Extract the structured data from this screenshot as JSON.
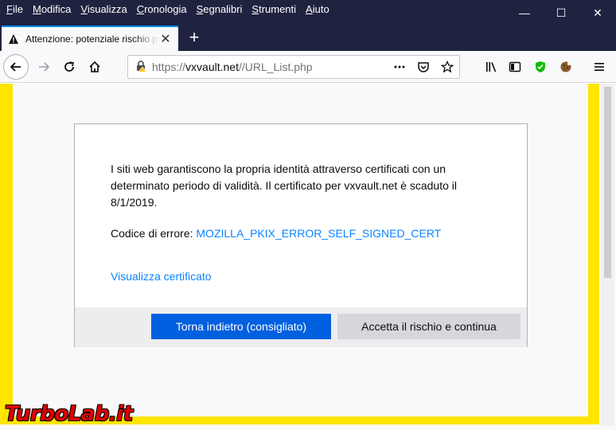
{
  "menu": [
    "File",
    "Modifica",
    "Visualizza",
    "Cronologia",
    "Segnalibri",
    "Strumenti",
    "Aiuto"
  ],
  "menu_access_keys": [
    "F",
    "M",
    "V",
    "C",
    "S",
    "S",
    "A"
  ],
  "window_controls": {
    "minimize": "—",
    "maximize": "☐",
    "close": "✕"
  },
  "tab": {
    "title": "Attenzione: potenziale rischio per la sicurezza",
    "icon": "warning-icon",
    "close": "✕"
  },
  "newtab": "+",
  "urlbar": {
    "scheme": "https://",
    "host": "vxvault.net",
    "path": "//URL_List.php"
  },
  "dialog": {
    "description": "I siti web garantiscono la propria identità attraverso certificati con un determinato periodo di validità. Il certificato per vxvault.net è scaduto il 8/1/2019.",
    "error_label": "Codice di errore: ",
    "error_code": "MOZILLA_PKIX_ERROR_SELF_SIGNED_CERT",
    "view_cert": "Visualizza certificato",
    "go_back": "Torna indietro (consigliato)",
    "accept": "Accetta il rischio e continua"
  },
  "watermark": "TurboLab.it",
  "colors": {
    "accent": "#0a84ff",
    "primary_button": "#0060df",
    "highlight": "#ffe500",
    "titlebar": "#202340"
  }
}
